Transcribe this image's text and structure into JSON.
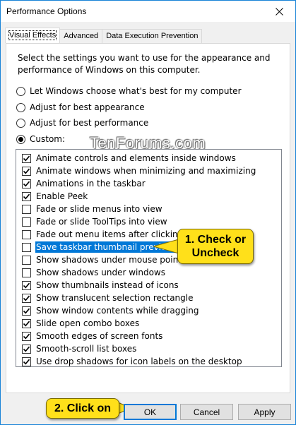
{
  "window": {
    "title": "Performance Options",
    "close_icon": "close-icon"
  },
  "tabs": [
    {
      "label": "Visual Effects",
      "active": true
    },
    {
      "label": "Advanced",
      "active": false
    },
    {
      "label": "Data Execution Prevention",
      "active": false
    }
  ],
  "description": "Select the settings you want to use for the appearance and performance of Windows on this computer.",
  "radios": [
    {
      "label": "Let Windows choose what's best for my computer",
      "checked": false
    },
    {
      "label": "Adjust for best appearance",
      "checked": false
    },
    {
      "label": "Adjust for best performance",
      "checked": false
    },
    {
      "label": "Custom:",
      "checked": true
    }
  ],
  "watermark": "TenForums.com",
  "settings": [
    {
      "label": "Animate controls and elements inside windows",
      "checked": true
    },
    {
      "label": "Animate windows when minimizing and maximizing",
      "checked": true
    },
    {
      "label": "Animations in the taskbar",
      "checked": true
    },
    {
      "label": "Enable Peek",
      "checked": true
    },
    {
      "label": "Fade or slide menus into view",
      "checked": false
    },
    {
      "label": "Fade or slide ToolTips into view",
      "checked": false
    },
    {
      "label": "Fade out menu items after clicking",
      "checked": false
    },
    {
      "label": "Save taskbar thumbnail previews",
      "checked": false,
      "selected": true
    },
    {
      "label": "Show shadows under mouse pointer",
      "checked": false
    },
    {
      "label": "Show shadows under windows",
      "checked": false
    },
    {
      "label": "Show thumbnails instead of icons",
      "checked": true
    },
    {
      "label": "Show translucent selection rectangle",
      "checked": true
    },
    {
      "label": "Show window contents while dragging",
      "checked": true
    },
    {
      "label": "Slide open combo boxes",
      "checked": true
    },
    {
      "label": "Smooth edges of screen fonts",
      "checked": true
    },
    {
      "label": "Smooth-scroll list boxes",
      "checked": true
    },
    {
      "label": "Use drop shadows for icon labels on the desktop",
      "checked": true
    }
  ],
  "callouts": {
    "step1_line1": "1. Check or",
    "step1_line2": "Uncheck",
    "step2": "2. Click on"
  },
  "buttons": {
    "ok": "OK",
    "cancel": "Cancel",
    "apply": "Apply"
  },
  "colors": {
    "accent": "#0078d7",
    "callout": "#ffe01a"
  }
}
